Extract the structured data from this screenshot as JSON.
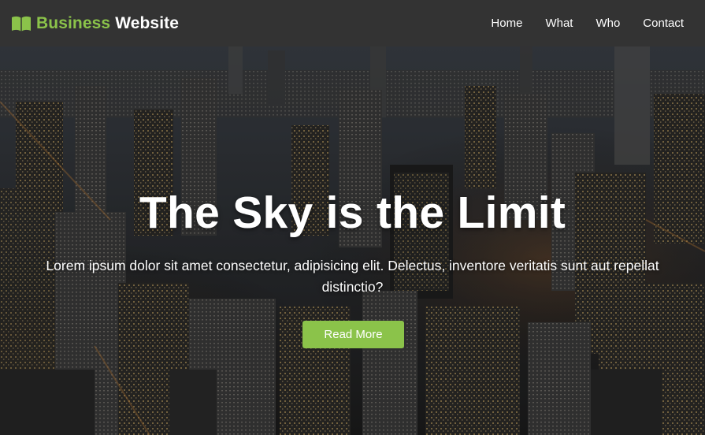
{
  "brand": {
    "accent_text": "Business",
    "main_text": "Website",
    "icon": "book-icon",
    "accent_color": "#8bc34a"
  },
  "nav": {
    "items": [
      {
        "label": "Home"
      },
      {
        "label": "What"
      },
      {
        "label": "Who"
      },
      {
        "label": "Contact"
      }
    ]
  },
  "hero": {
    "title": "The Sky is the Limit",
    "text": "Lorem ipsum dolor sit amet consectetur, adipisicing elit. Delectus, inventore veritatis sunt aut repellat distinctio?",
    "button_label": "Read More",
    "background": "night-city-aerial-photo"
  },
  "colors": {
    "navbar": "#333333",
    "accent": "#8bc34a",
    "text": "#ffffff"
  }
}
